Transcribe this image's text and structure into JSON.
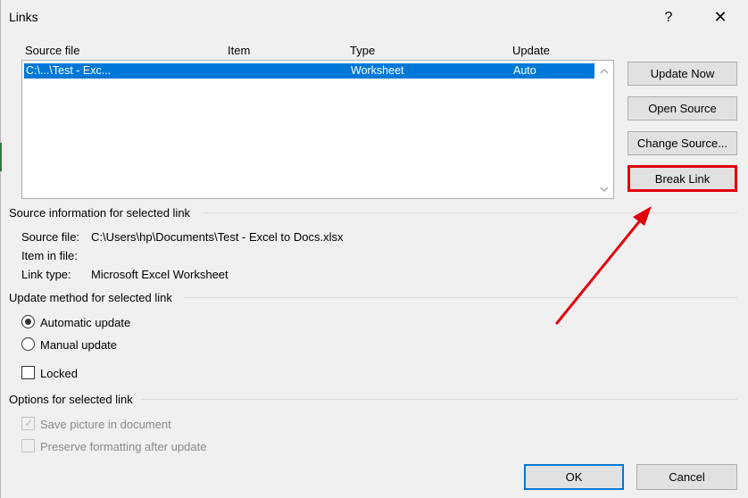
{
  "dialog": {
    "title": "Links",
    "help_symbol": "?",
    "close_symbol": "✕"
  },
  "list": {
    "columns": [
      "Source file",
      "Item",
      "Type",
      "Update"
    ],
    "rows": [
      {
        "source": "C:\\...\\Test - Exc...",
        "item": "",
        "type": "Worksheet",
        "update": "Auto",
        "selected": true
      }
    ]
  },
  "buttons": {
    "update_now": "Update Now",
    "open_source": "Open Source",
    "change_source": "Change Source...",
    "break_link": "Break Link"
  },
  "source_info": {
    "heading": "Source information for selected link",
    "source_file_label": "Source file:",
    "source_file_value": "C:\\Users\\hp\\Documents\\Test - Excel to Docs.xlsx",
    "item_label": "Item in file:",
    "item_value": "",
    "link_type_label": "Link type:",
    "link_type_value": "Microsoft Excel Worksheet"
  },
  "update_method": {
    "heading": "Update method for selected link",
    "automatic": "Automatic update",
    "manual": "Manual update",
    "locked": "Locked",
    "selected": "automatic"
  },
  "options": {
    "heading": "Options for selected link",
    "save_picture": "Save picture in document",
    "preserve_formatting": "Preserve formatting after update"
  },
  "footer": {
    "ok": "OK",
    "cancel": "Cancel"
  },
  "colors": {
    "selection": "#0078d7",
    "annotation": "#e0000c"
  }
}
